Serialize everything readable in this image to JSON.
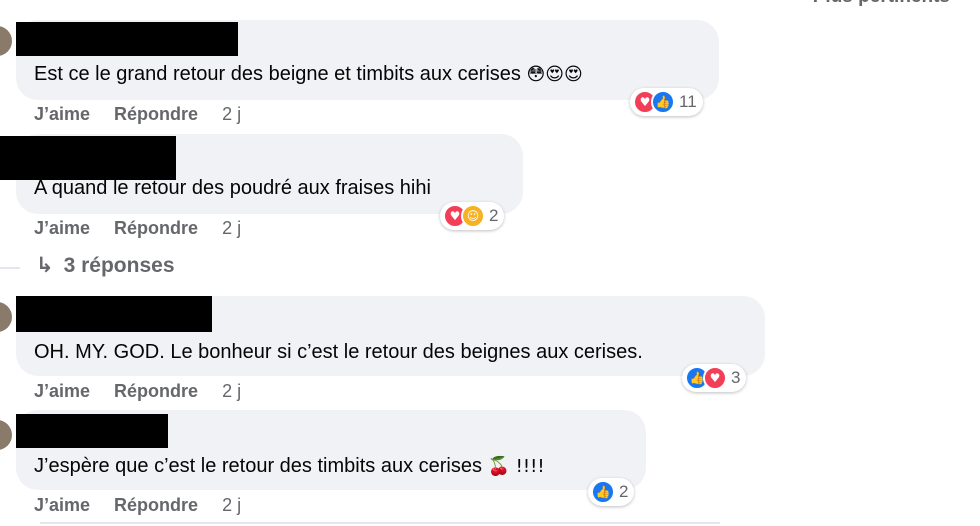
{
  "sort_label": "Plus pertinents",
  "comments": [
    {
      "text": "Est ce le grand retour des beigne et timbits aux cerises",
      "emojis": "😳😍😍",
      "actions": {
        "like": "J’aime",
        "reply": "Répondre",
        "time": "2 j"
      },
      "reactions": {
        "icons": [
          "love",
          "like"
        ],
        "count": "11"
      }
    },
    {
      "text": "A quand le retour des poudré aux fraises hihi",
      "emojis": "",
      "actions": {
        "like": "J’aime",
        "reply": "Répondre",
        "time": "2 j"
      },
      "reactions": {
        "icons": [
          "love",
          "care"
        ],
        "count": "2"
      }
    },
    {
      "text": "OH. MY. GOD. Le bonheur si c’est le retour des beignes aux cerises.",
      "emojis": "",
      "actions": {
        "like": "J’aime",
        "reply": "Répondre",
        "time": "2 j"
      },
      "reactions": {
        "icons": [
          "like",
          "love"
        ],
        "count": "3"
      }
    },
    {
      "text": "J’espère que c’est le retour des timbits aux cerises",
      "emojis": "🍒 !!!!",
      "actions": {
        "like": "J’aime",
        "reply": "Répondre",
        "time": "2 j"
      },
      "reactions": {
        "icons": [
          "like"
        ],
        "count": "2"
      }
    }
  ],
  "replies": {
    "icon": "reply-arrow-icon",
    "label": "3 réponses"
  },
  "colors": {
    "bubble": "#f0f2f5",
    "muted_text": "#65676b",
    "like_blue": "#1877f2",
    "love_red": "#f33e58",
    "care_yellow": "#f7b125"
  }
}
